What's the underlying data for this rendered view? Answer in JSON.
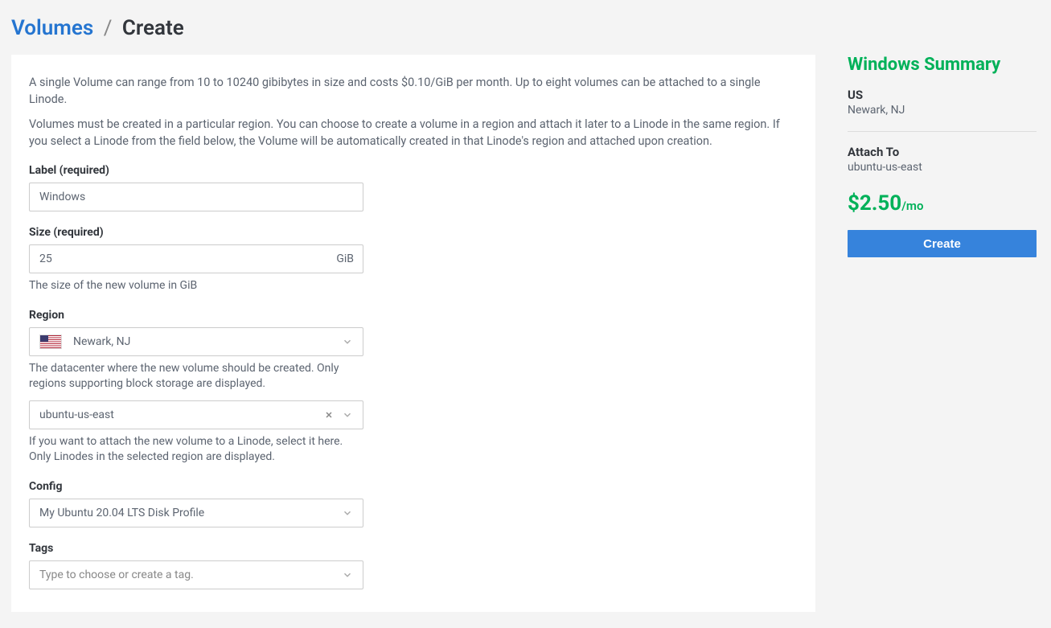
{
  "breadcrumb": {
    "parent": "Volumes",
    "current": "Create"
  },
  "intro": {
    "p1": "A single Volume can range from 10 to 10240 gibibytes in size and costs $0.10/GiB per month. Up to eight volumes can be attached to a single Linode.",
    "p2": "Volumes must be created in a particular region. You can choose to create a volume in a region and attach it later to a Linode in the same region. If you select a Linode from the field below, the Volume will be automatically created in that Linode's region and attached upon creation."
  },
  "form": {
    "label": {
      "title": "Label (required)",
      "value": "Windows"
    },
    "size": {
      "title": "Size (required)",
      "value": "25",
      "suffix": "GiB",
      "help": "The size of the new volume in GiB"
    },
    "region": {
      "title": "Region",
      "value": "Newark, NJ",
      "help": "The datacenter where the new volume should be created. Only regions supporting block storage are displayed."
    },
    "linode": {
      "value": "ubuntu-us-east",
      "help": "If you want to attach the new volume to a Linode, select it here. Only Linodes in the selected region are displayed."
    },
    "config": {
      "title": "Config",
      "value": "My Ubuntu 20.04 LTS Disk Profile"
    },
    "tags": {
      "title": "Tags",
      "placeholder": "Type to choose or create a tag."
    }
  },
  "summary": {
    "title": "Windows Summary",
    "country": "US",
    "location": "Newark, NJ",
    "attach_label": "Attach To",
    "attach_value": "ubuntu-us-east",
    "price_amount": "$2.50",
    "price_period": "/mo",
    "button": "Create"
  }
}
